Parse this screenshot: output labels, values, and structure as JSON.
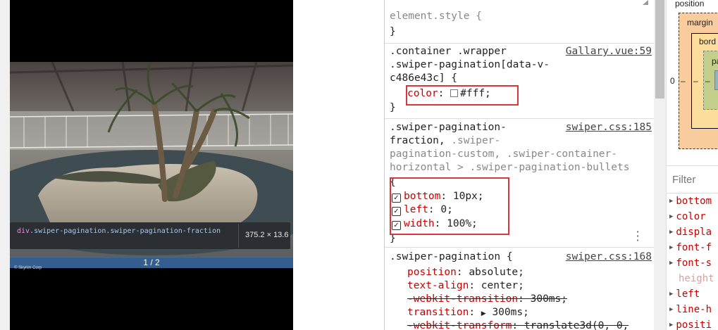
{
  "preview": {
    "pagination_text": "1 / 2",
    "watermark": "© Skyrim Corp",
    "tooltip": {
      "tag": "div",
      "selector": ".swiper-pagination.swiper-pagination-fraction",
      "dimensions": "375.2 × 13.6"
    }
  },
  "styles": {
    "rule0": {
      "selector": "element.style {",
      "close": "}"
    },
    "rule1": {
      "sel1": ".container .wrapper",
      "sel2": ".swiper-pagination[data-v-",
      "sel3": "c486e43c] {",
      "source": "Gallary.vue:59",
      "prop": "color",
      "value": "#fff;",
      "close": "}"
    },
    "rule2": {
      "sel1": ".swiper-pagination-",
      "sel2a": "fraction,",
      "sel2b": " .swiper-",
      "sel3": "pagination-custom, .swiper-container-",
      "sel4": "horizontal > .swiper-pagination-bullets",
      "open": "{",
      "source": "swiper.css:185",
      "decls": [
        {
          "prop": "bottom",
          "value": "10px;"
        },
        {
          "prop": "left",
          "value": "0;"
        },
        {
          "prop": "width",
          "value": "100%;"
        }
      ],
      "close": "}"
    },
    "rule3": {
      "selector": ".swiper-pagination {",
      "source": "swiper.css:168",
      "decls": [
        {
          "prop": "position",
          "value": "absolute;"
        },
        {
          "prop": "text-align",
          "value": "center;"
        },
        {
          "prop": "-webkit-transition",
          "value": "300ms;"
        },
        {
          "prop": "transition",
          "value": "300ms;"
        },
        {
          "prop": "-webkit-transform",
          "value": "translate3d(0, 0,"
        }
      ]
    }
  },
  "computed": {
    "position_label": "position",
    "margin_label": "margin",
    "border_label": "bord",
    "padding_label": "pa",
    "left_value": "0",
    "dash": "–",
    "filter_placeholder": "Filter",
    "properties": [
      "bottom",
      "color",
      "displa",
      "font-f",
      "font-s",
      "height",
      "left",
      "line-h",
      "positi"
    ]
  },
  "colors": {
    "highlight": "#d9353a",
    "property": "#c80000",
    "pagination_bar": "#3c6fa8"
  }
}
